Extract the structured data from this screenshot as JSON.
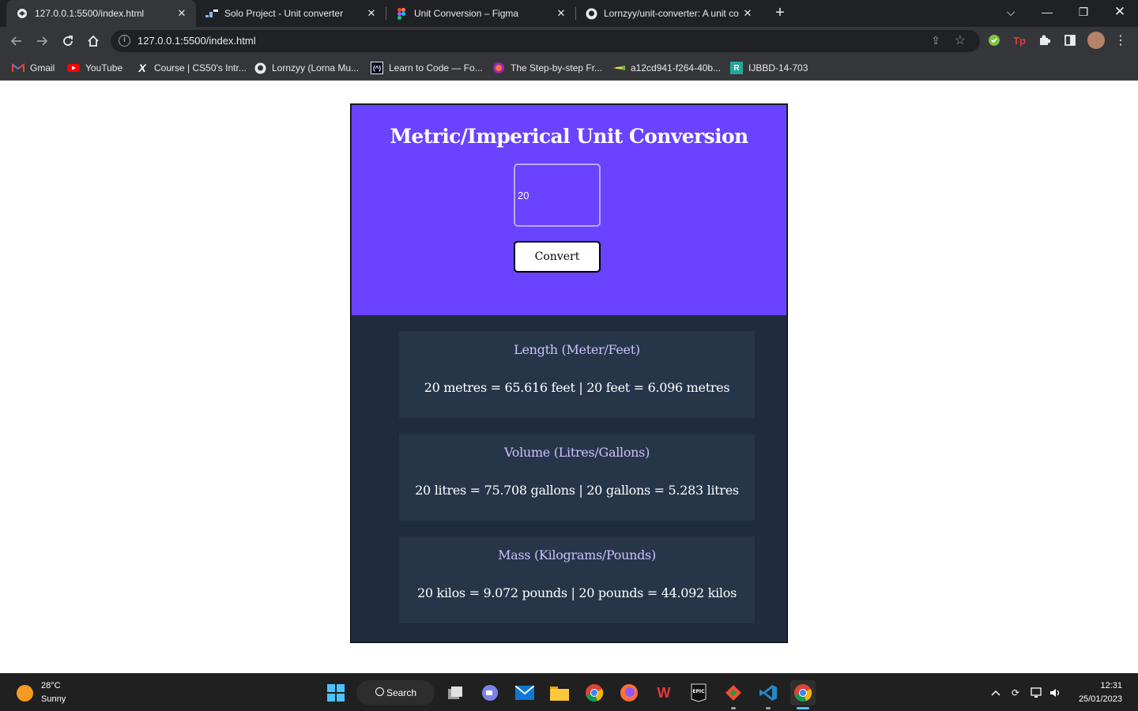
{
  "browser": {
    "tabs": [
      {
        "title": "127.0.0.1:5500/index.html",
        "icon": "globe-icon",
        "active": true
      },
      {
        "title": "Solo Project - Unit converter",
        "icon": "scrimba-icon",
        "active": false
      },
      {
        "title": "Unit Conversion – Figma",
        "icon": "figma-icon",
        "active": false
      },
      {
        "title": "Lornzyy/unit-converter: A unit co",
        "icon": "github-icon",
        "active": false
      }
    ],
    "url": "127.0.0.1:5500/index.html",
    "bookmarks": [
      {
        "label": "Gmail",
        "icon": "gmail-icon"
      },
      {
        "label": "YouTube",
        "icon": "youtube-icon"
      },
      {
        "label": "Course | CS50's Intr...",
        "icon": "edx-icon"
      },
      {
        "label": "Lornzyy (Lorna Mu...",
        "icon": "github-icon"
      },
      {
        "label": "Learn to Code — Fo...",
        "icon": "freecodecamp-icon"
      },
      {
        "label": "The Step-by-step Fr...",
        "icon": "colorful-icon"
      },
      {
        "label": "a12cd941-f264-40b...",
        "icon": "plane-icon"
      },
      {
        "label": "IJBBD-14-703",
        "icon": "r-icon"
      }
    ]
  },
  "app": {
    "title": "Metric/Imperical Unit Conversion",
    "input_value": "20",
    "button_label": "Convert",
    "cards": [
      {
        "title": "Length (Meter/Feet)",
        "result": "20 metres = 65.616 feet | 20 feet = 6.096 metres"
      },
      {
        "title": "Volume (Litres/Gallons)",
        "result": "20 litres = 75.708 gallons | 20 gallons = 5.283 litres"
      },
      {
        "title": "Mass (Kilograms/Pounds)",
        "result": "20 kilos = 9.072 pounds | 20 pounds = 44.092 kilos"
      }
    ],
    "colors": {
      "hero": "#6943ff",
      "body": "#1f2b3e",
      "card": "#273549",
      "card_title": "#ccc1ff"
    }
  },
  "taskbar": {
    "weather_temp": "28°C",
    "weather_condition": "Sunny",
    "search_label": "Search",
    "time": "12:31",
    "date": "25/01/2023"
  }
}
